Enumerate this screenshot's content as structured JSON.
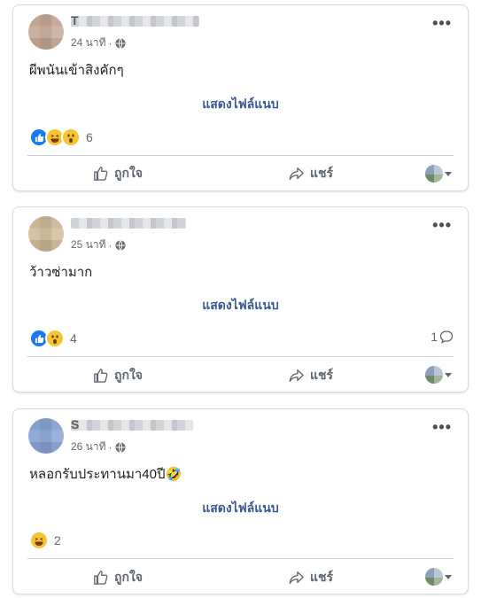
{
  "posts": [
    {
      "author_initial": "T",
      "time": "24 นาที",
      "separator": "·",
      "text": "ผีพนันเข้าสิงคักๆ",
      "attachment_label": "แสดงไฟล์แนบ",
      "reactions": [
        "like",
        "haha",
        "wow"
      ],
      "reaction_count": "6",
      "comment_count": ""
    },
    {
      "author_initial": "",
      "time": "25 นาที",
      "separator": "·",
      "text": "ว้าวซ่ามาก",
      "attachment_label": "แสดงไฟล์แนบ",
      "reactions": [
        "like",
        "wow"
      ],
      "reaction_count": "4",
      "comment_count": "1"
    },
    {
      "author_initial": "S",
      "time": "26 นาที",
      "separator": "·",
      "text": "หลอกรับประทานมา40ปี🤣",
      "attachment_label": "แสดงไฟล์แนบ",
      "reactions": [
        "haha"
      ],
      "reaction_count": "2",
      "comment_count": ""
    }
  ],
  "actions": {
    "like_label": "ถูกใจ",
    "share_label": "แชร์"
  },
  "icons": {
    "like": "thumbs-up-icon",
    "share": "share-arrow-icon",
    "globe": "globe-icon",
    "comment": "comment-bubble-icon",
    "more": "more-dots-icon"
  },
  "colors": {
    "link": "#385898",
    "like_blue": "#1877f2",
    "emoji_yellow": "#f7c432"
  }
}
